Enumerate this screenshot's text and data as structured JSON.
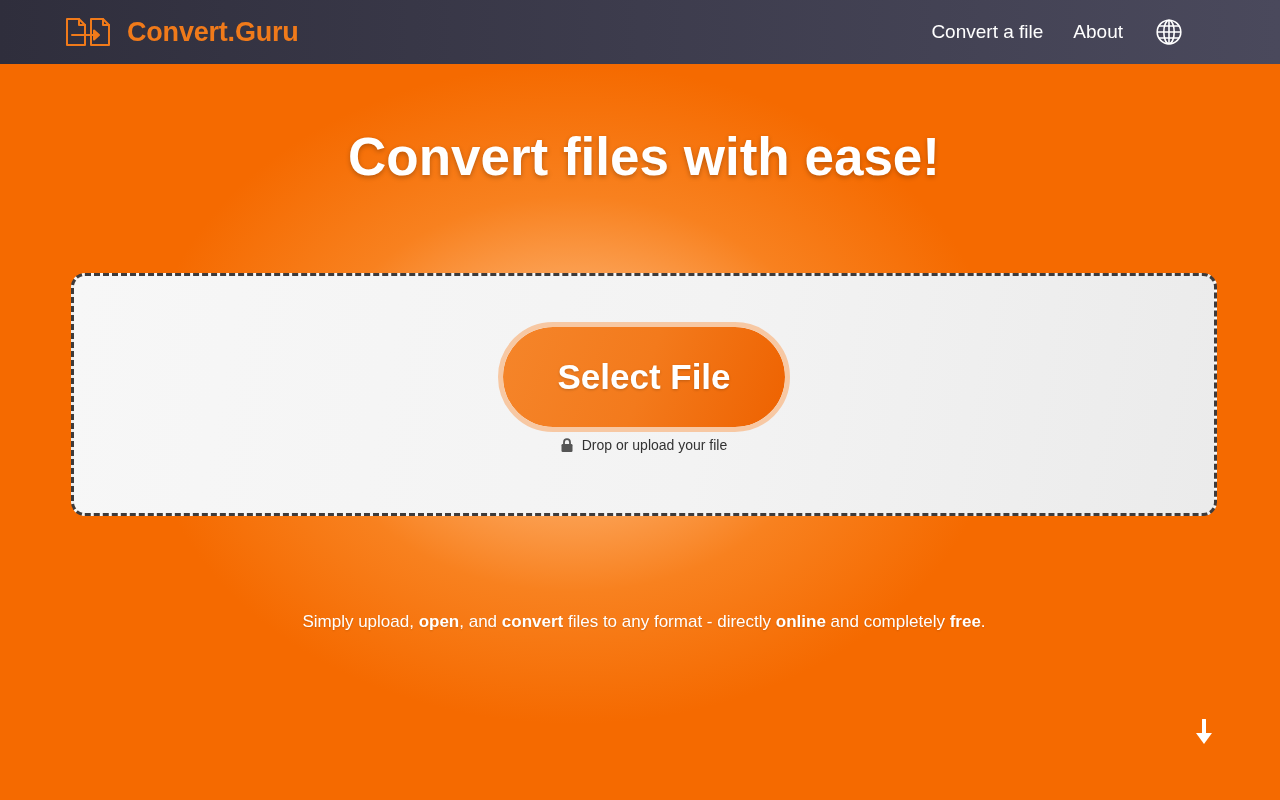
{
  "header": {
    "logo_text": "Convert.Guru",
    "nav": [
      {
        "label": "Convert a file"
      },
      {
        "label": "About"
      }
    ]
  },
  "hero": {
    "heading": "Convert files with ease!"
  },
  "upload": {
    "button": "Select File",
    "hint": "Drop or upload your file"
  },
  "tagline": "Simply upload, **open**, and **convert** files to any format - directly **online** and completely **free**."
}
